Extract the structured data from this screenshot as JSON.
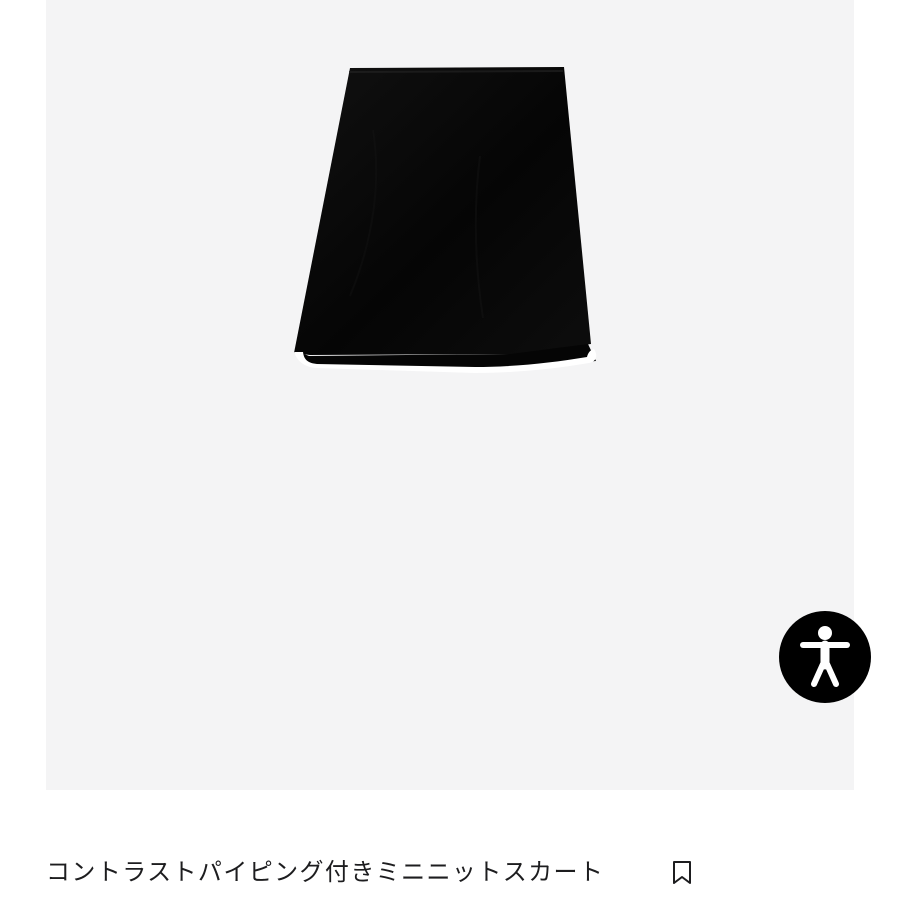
{
  "product": {
    "title": "コントラストパイピング付きミニニットスカート",
    "image_subject": "black mini knit skirt with white contrast piping"
  },
  "icons": {
    "accessibility": "accessibility-person-icon",
    "bookmark": "bookmark-icon"
  },
  "colors": {
    "background": "#ffffff",
    "image_area": "#f4f4f5",
    "skirt": "#050505",
    "piping": "#ffffff",
    "accessibility_button": "#000000",
    "text": "#1d1d1f"
  }
}
